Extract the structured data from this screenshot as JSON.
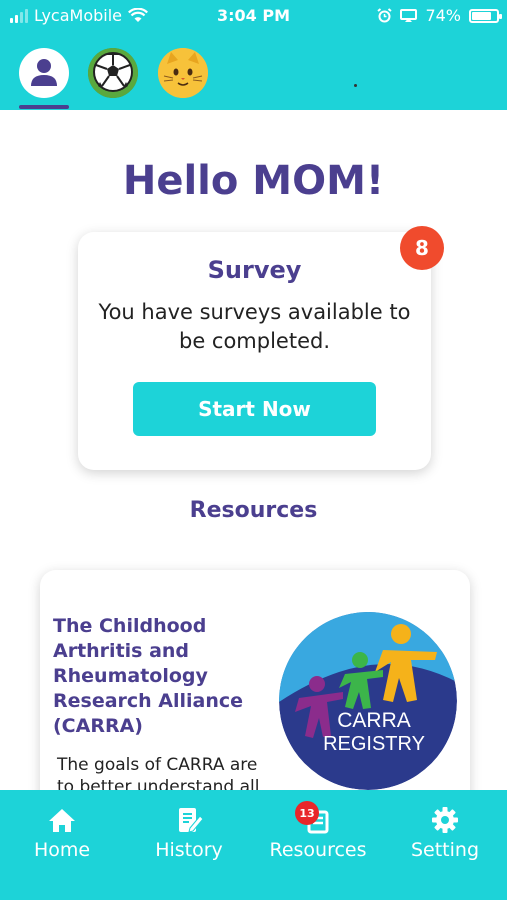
{
  "status_bar": {
    "carrier": "LycaMobile",
    "time": "3:04 PM",
    "battery": "74%",
    "battery_level": 0.74
  },
  "profiles": [
    {
      "icon": "user-avatar-icon",
      "active": true
    },
    {
      "icon": "soccer-ball-avatar-icon",
      "active": false
    },
    {
      "icon": "cat-avatar-icon",
      "active": false
    }
  ],
  "greeting": "Hello MOM!",
  "survey": {
    "title": "Survey",
    "text": "You have surveys available to be completed.",
    "button_label": "Start Now",
    "badge_count": "8"
  },
  "resources": {
    "heading": "Resources",
    "card": {
      "title": "The Childhood Arthritis and Rheumatology Research Alliance (CARRA)",
      "description": "The goals of CARRA are to better understand all",
      "logo_text_line1": "CARRA",
      "logo_text_line2": "REGISTRY"
    }
  },
  "bottom_nav": {
    "items": [
      {
        "label": "Home",
        "icon": "home-icon"
      },
      {
        "label": "History",
        "icon": "history-icon"
      },
      {
        "label": "Resources",
        "icon": "resources-icon",
        "badge": "13"
      },
      {
        "label": "Setting",
        "icon": "gear-icon"
      }
    ]
  },
  "colors": {
    "accent": "#1dd3d8",
    "primary_text": "#4b3f8f",
    "badge": "#f04b2d"
  }
}
